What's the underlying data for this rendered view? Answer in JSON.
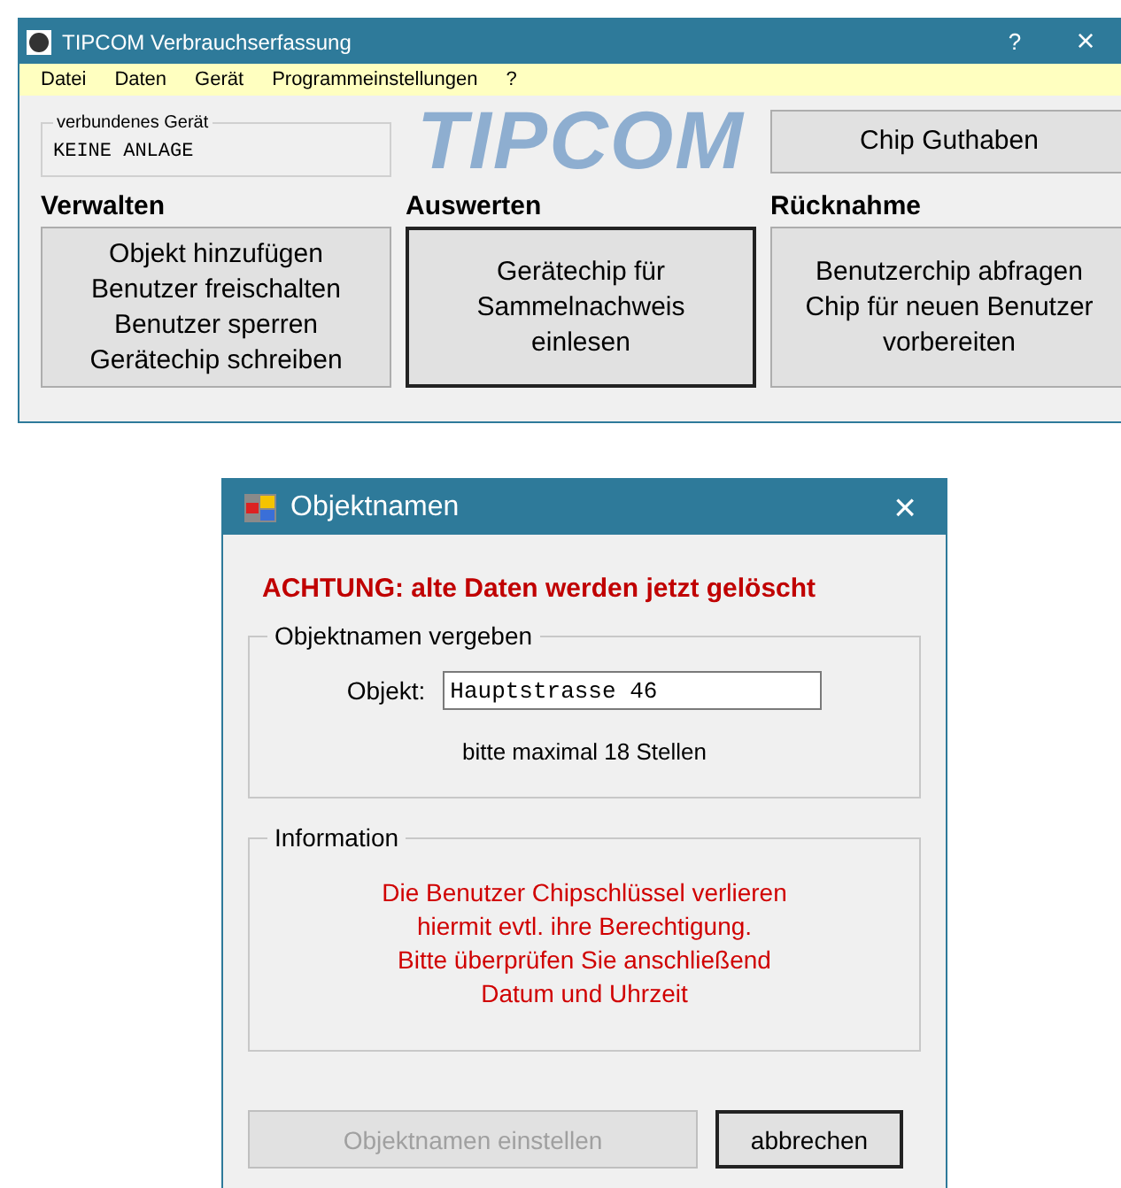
{
  "main_window": {
    "title": "TIPCOM Verbrauchserfassung",
    "title_buttons": [
      "?",
      "×"
    ]
  },
  "menu": [
    "Datei",
    "Daten",
    "Gerät",
    "Programmeinstellungen",
    "?"
  ],
  "device_group": {
    "label": "verbundenes Gerät",
    "value": "KEINE ANLAGE"
  },
  "logo": "TIPCOM",
  "chip_button": {
    "label": "Chip Guthaben",
    "default": false
  },
  "sections": [
    {
      "title": "Verwalten",
      "button": {
        "lines": [
          "Objekt hinzufügen",
          "Benutzer freischalten",
          "Benutzer sperren",
          "Gerätechip schreiben"
        ],
        "default": false
      }
    },
    {
      "title": "Auswerten",
      "button": {
        "lines": [
          "Gerätechip für",
          "Sammelnachweis",
          "einlesen"
        ],
        "default": true
      }
    },
    {
      "title": "Rücknahme",
      "button": {
        "lines": [
          "Benutzerchip abfragen",
          "Chip für neuen Benutzer",
          "vorbereiten"
        ],
        "default": false
      }
    }
  ],
  "dialog": {
    "title": "Objektnamen",
    "close": "×",
    "warning": "ACHTUNG: alte Daten werden jetzt gelöscht",
    "name_group": {
      "label": "Objektnamen vergeben",
      "field_label": "Objekt:",
      "value": "Hauptstrasse 46",
      "hint": "bitte maximal 18 Stellen"
    },
    "info_group": {
      "label": "Information",
      "lines": [
        "Die Benutzer Chipschlüssel verlieren",
        "hiermit evtl. ihre Berechtigung.",
        "Bitte überprüfen Sie anschließend",
        "Datum und Uhrzeit"
      ]
    },
    "buttons": [
      {
        "label": "Objektnamen einstellen",
        "disabled": true,
        "default": false
      },
      {
        "label": "abbrechen",
        "disabled": false,
        "default": true
      }
    ]
  }
}
